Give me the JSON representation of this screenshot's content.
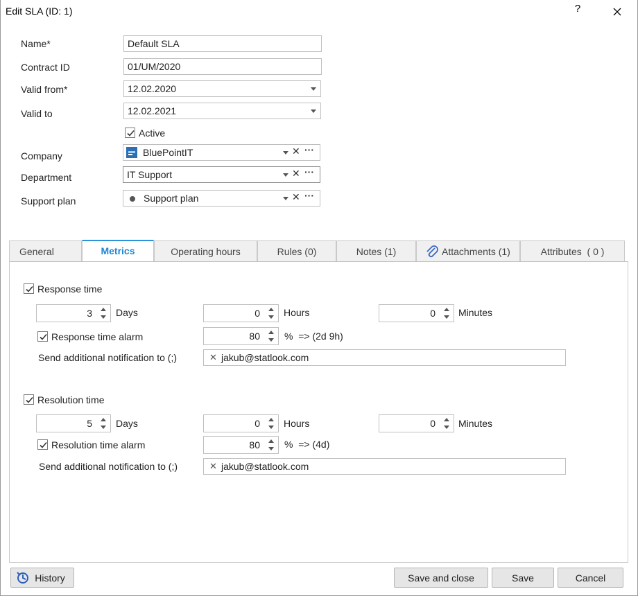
{
  "window": {
    "title": "Edit SLA (ID: 1)",
    "help": "?"
  },
  "form": {
    "name_label": "Name*",
    "name_value": "Default SLA",
    "contract_label": "Contract ID",
    "contract_value": "01/UM/2020",
    "valid_from_label": "Valid from*",
    "valid_from_value": "12.02.2020",
    "valid_to_label": "Valid to",
    "valid_to_value": "12.02.2021",
    "active_label": "Active",
    "active_checked": true,
    "company_label": "Company",
    "company_value": "BluePointIT",
    "department_label": "Department",
    "department_value": "IT Support",
    "plan_label": "Support plan",
    "plan_value": "Support plan"
  },
  "tabs": [
    {
      "label": "General"
    },
    {
      "label": "Metrics",
      "active": true
    },
    {
      "label": "Operating hours"
    },
    {
      "label": "Rules (0)"
    },
    {
      "label": "Notes (1)"
    },
    {
      "label": "Attachments (1)"
    },
    {
      "label": "Attributes  ( 0 )"
    }
  ],
  "metrics": {
    "response": {
      "label": "Response time",
      "checked": true,
      "days": "3",
      "days_unit": "Days",
      "hours": "0",
      "hours_unit": "Hours",
      "minutes": "0",
      "minutes_unit": "Minutes",
      "alarm_label": "Response time alarm",
      "alarm_checked": true,
      "alarm_value": "80",
      "alarm_suffix": "%  => (2d 9h)",
      "notify_label": "Send additional notification to (;)",
      "notify_email": "jakub@statlook.com"
    },
    "resolution": {
      "label": "Resolution time",
      "checked": true,
      "days": "5",
      "days_unit": "Days",
      "hours": "0",
      "hours_unit": "Hours",
      "minutes": "0",
      "minutes_unit": "Minutes",
      "alarm_label": "Resolution time alarm",
      "alarm_checked": true,
      "alarm_value": "80",
      "alarm_suffix": "%  => (4d)",
      "notify_label": "Send additional notification to (;)",
      "notify_email": "jakub@statlook.com"
    }
  },
  "footer": {
    "history": "History",
    "save_close": "Save and close",
    "save": "Save",
    "cancel": "Cancel"
  },
  "colors": {
    "accent": "#1f86d0",
    "tab_border": "#2b93d9"
  },
  "icons": [
    "close-icon",
    "help-icon",
    "company-logo-icon",
    "dot-icon",
    "paperclip-icon",
    "history-icon",
    "checkmark-icon"
  ]
}
